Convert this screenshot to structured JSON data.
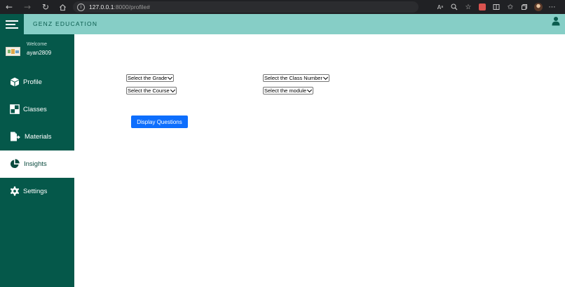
{
  "browser": {
    "url_host": "127.0.0.1",
    "url_path": ":8000/profile#",
    "icons": [
      "back-icon",
      "forward-icon",
      "refresh-icon",
      "home-icon",
      "info-icon",
      "read-aloud-icon",
      "zoom-icon",
      "favorite-add-icon",
      "extension-icon",
      "split-screen-icon",
      "favorites-icon",
      "collections-icon",
      "profile-icon"
    ]
  },
  "header": {
    "brand": "GENZ EDUCATION",
    "colors": {
      "header_bg": "#86cec6",
      "sidebar_bg": "#05584a",
      "accent": "#0d6efd"
    }
  },
  "sidebar": {
    "welcome_label": "Welcome",
    "username": "ayan2809",
    "items": [
      {
        "label": "Profile",
        "icon": "cube-icon",
        "active": false
      },
      {
        "label": "Classes",
        "icon": "grid-icon",
        "active": false
      },
      {
        "label": "Materials",
        "icon": "file-export-icon",
        "active": false
      },
      {
        "label": "Insights",
        "icon": "pie-chart-icon",
        "active": true
      },
      {
        "label": "Settings",
        "icon": "gear-icon",
        "active": false
      }
    ]
  },
  "main": {
    "grade_select": "Select the Grade",
    "class_select": "Select the Class Number",
    "course_select": "Select the Course",
    "module_select": "Select the module",
    "display_button": "Display Questions"
  }
}
